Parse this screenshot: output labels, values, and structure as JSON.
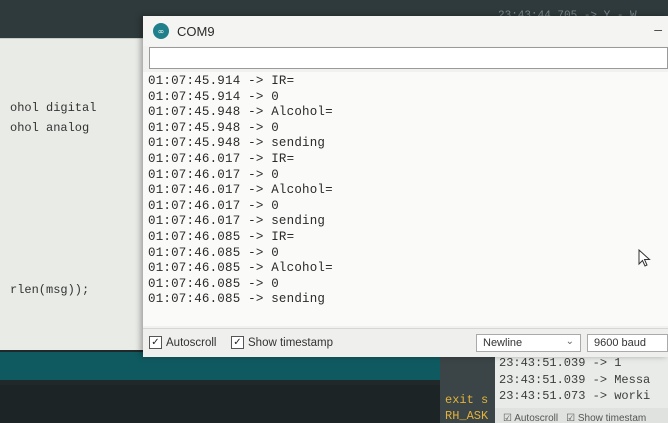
{
  "ide": {
    "editor_lines": [
      {
        "text": "ohol digital"
      },
      {
        "text": "ohol analog"
      },
      {
        "text": "rlen(msg));"
      }
    ],
    "console_lines": [
      {
        "text": "exit s",
        "color": "#e2b23a"
      },
      {
        "text": "RH_ASK",
        "color": "#e2b23a"
      }
    ],
    "top_strip_text": "23:43:44.705 -> Y - W"
  },
  "background_monitor": {
    "lines": [
      "23:43:51.039 -> 1",
      "23:43:51.039 -> Messa",
      "23:43:51.073 -> worki"
    ],
    "autoscroll_label": "Autoscroll",
    "show_timestamp_label": "Show timestam"
  },
  "monitor": {
    "title": "COM9",
    "output_lines": [
      "01:07:45.914 -> IR=",
      "01:07:45.914 -> 0",
      "01:07:45.948 -> Alcohol=",
      "01:07:45.948 -> 0",
      "01:07:45.948 -> sending",
      "01:07:46.017 -> IR=",
      "01:07:46.017 -> 0",
      "01:07:46.017 -> Alcohol=",
      "01:07:46.017 -> 0",
      "01:07:46.017 -> sending",
      "01:07:46.085 -> IR=",
      "01:07:46.085 -> 0",
      "01:07:46.085 -> Alcohol=",
      "01:07:46.085 -> 0",
      "01:07:46.085 -> sending"
    ],
    "autoscroll_label": "Autoscroll",
    "autoscroll_checked": true,
    "show_timestamp_label": "Show timestamp",
    "show_timestamp_checked": true,
    "line_ending": "Newline",
    "baud": "9600 baud"
  }
}
